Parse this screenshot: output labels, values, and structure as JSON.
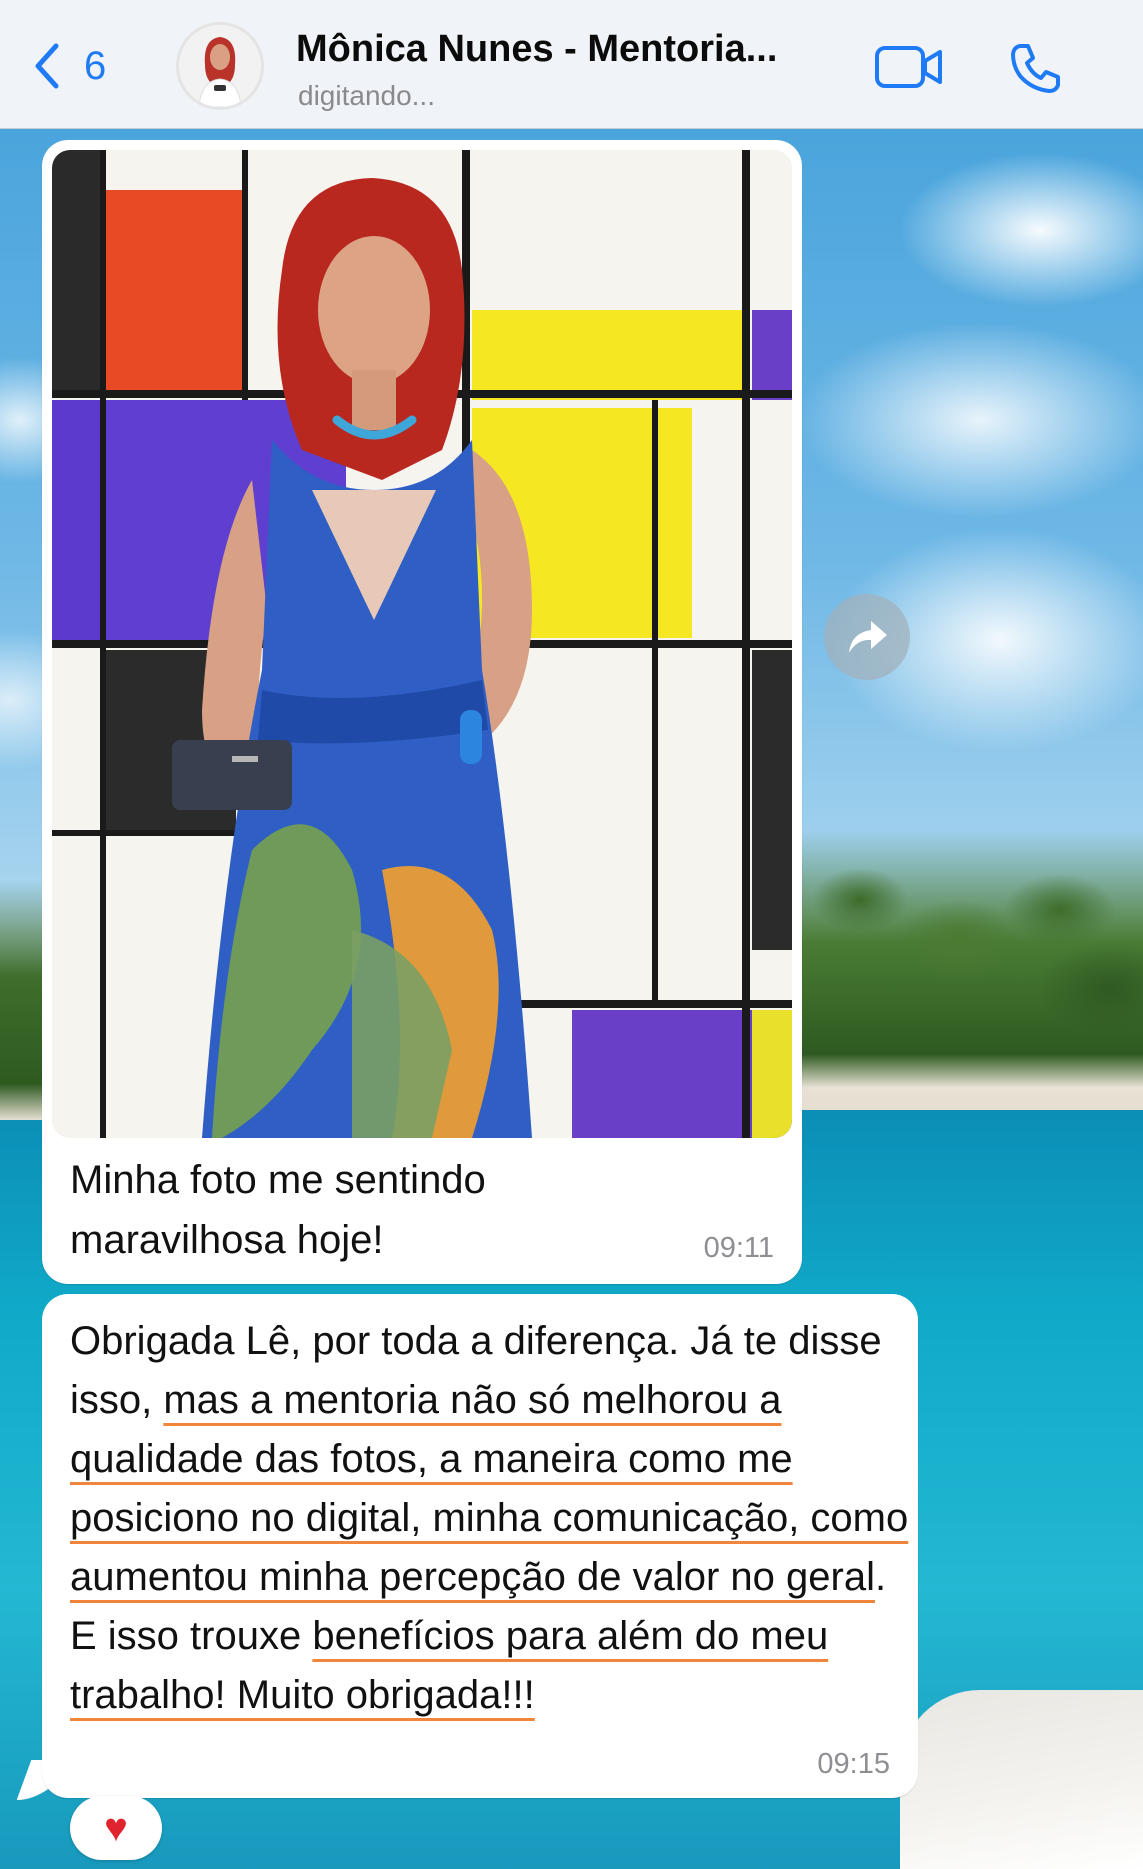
{
  "header": {
    "back_count": "6",
    "title": "Mônica Nunes - Mentoria...",
    "status": "digitando..."
  },
  "messages": [
    {
      "type": "image",
      "caption": "Minha foto me sentindo\nmaravilhosa hoje!",
      "time": "09:11"
    },
    {
      "type": "text",
      "time": "09:15",
      "segments": [
        {
          "text": "Obrigada Lê, por toda a diferença. Já te disse isso, ",
          "highlight": false
        },
        {
          "text": "mas a mentoria não só melhorou a qualidade das fotos, a maneira como me posiciono no digital, minha comunicação, como aumentou minha percepção de valor no geral",
          "highlight": true
        },
        {
          "text": ". E isso trouxe ",
          "highlight": false
        },
        {
          "text": "benefícios para além do meu trabalho! Muito obrigada!!!",
          "highlight": true
        }
      ]
    }
  ],
  "reaction": "♥",
  "icons": {
    "back": "chevron-left-icon",
    "video": "video-camera-icon",
    "call": "phone-icon",
    "forward": "forward-arrow-icon"
  },
  "colors": {
    "accent": "#1f7bf5",
    "highlight_underline": "#f0853b",
    "bubble": "#ffffff",
    "timestamp": "#8e8e93"
  }
}
